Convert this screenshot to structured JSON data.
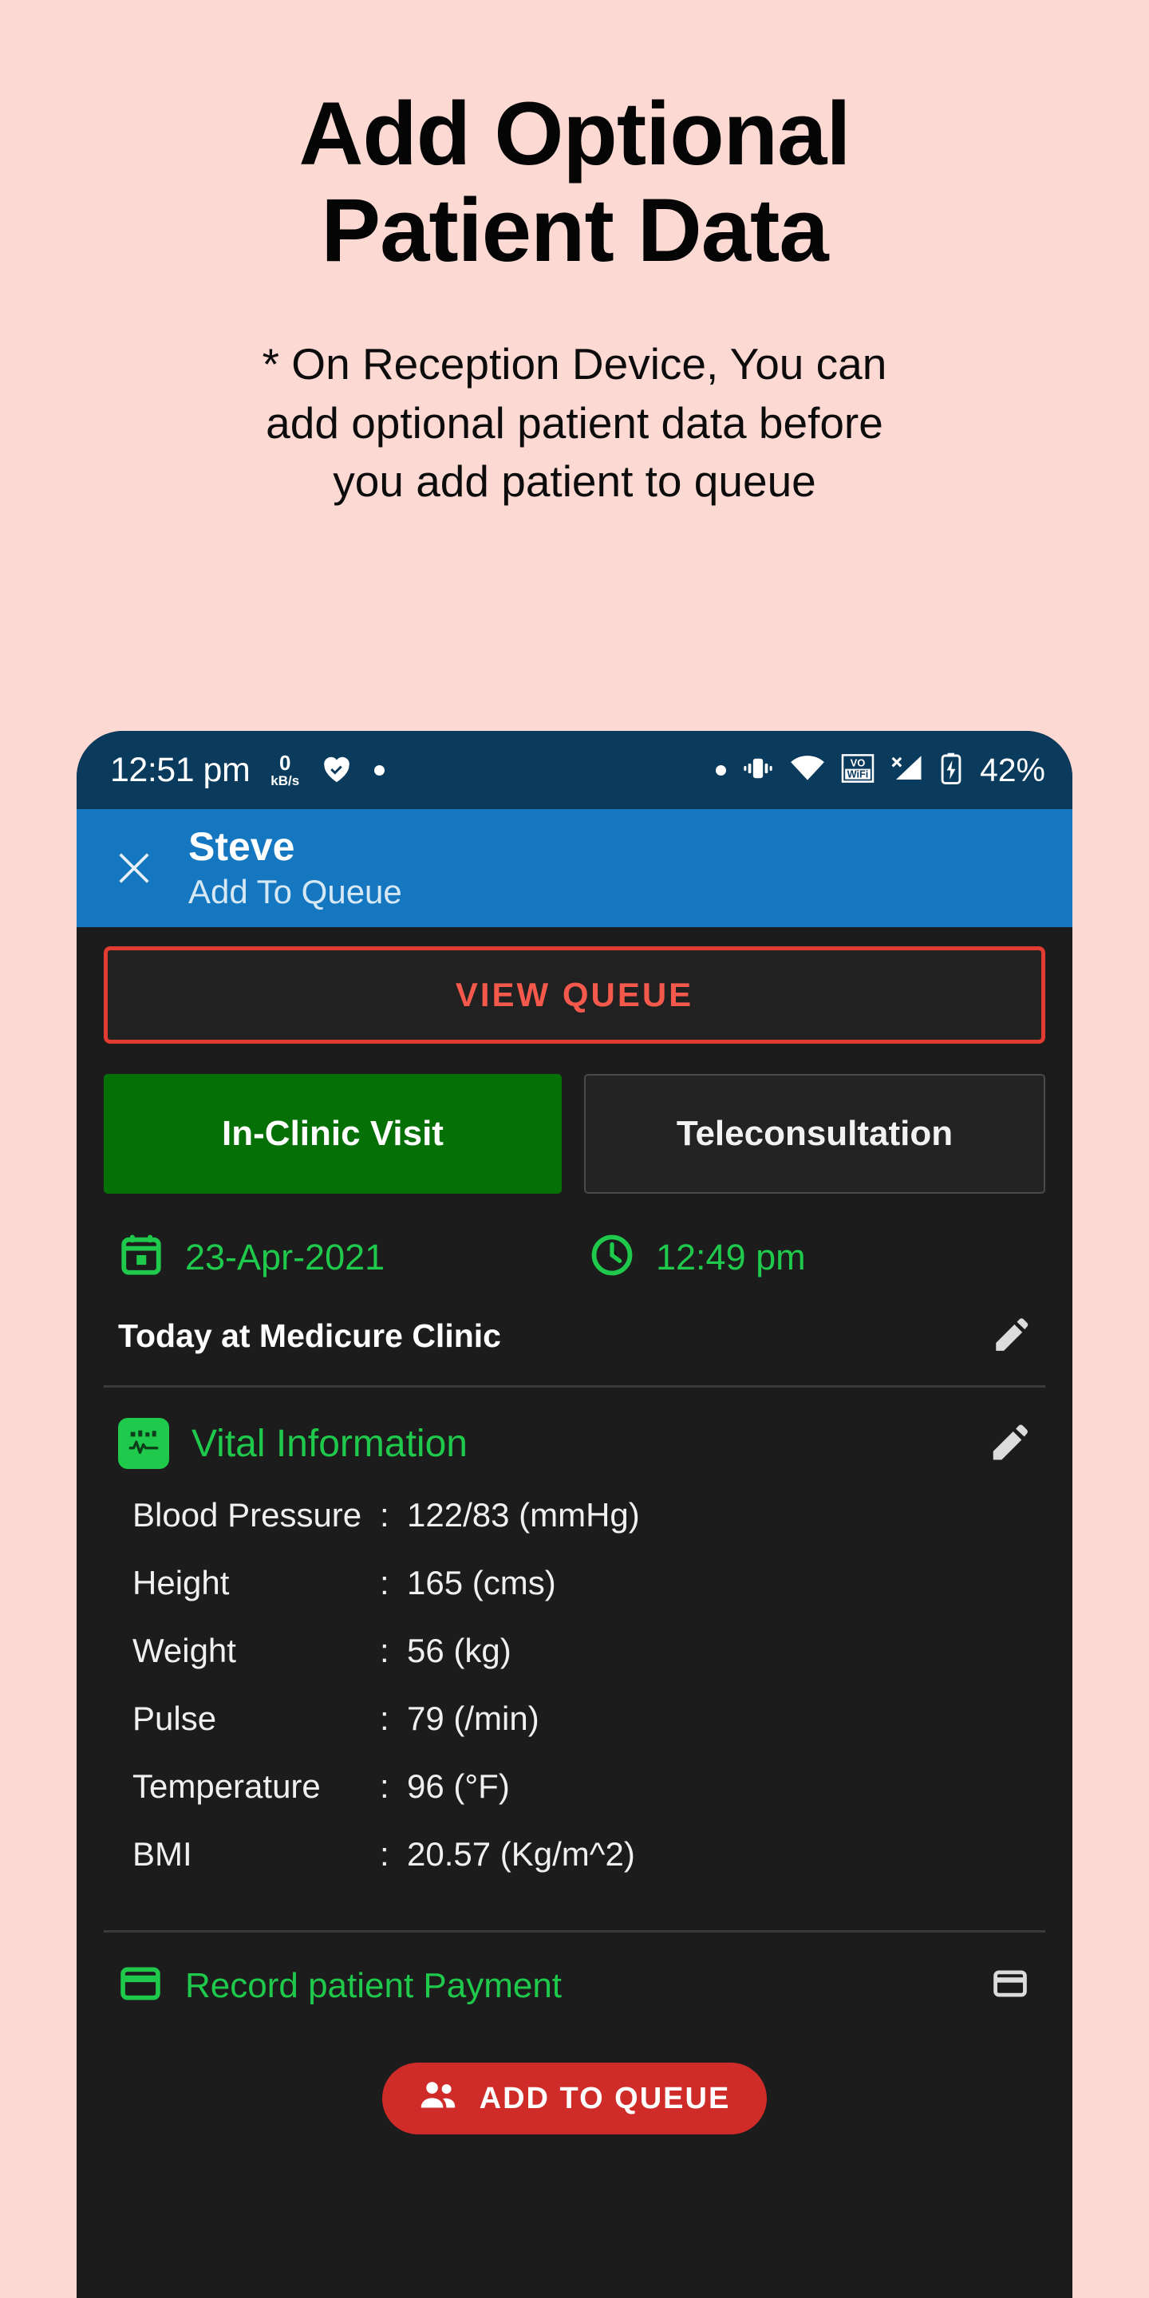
{
  "promo": {
    "headline_lines": [
      "Add Optional",
      "Patient Data"
    ],
    "subtitle_lines": [
      "* On Reception Device, You can",
      "add optional patient data before",
      "you add patient to queue"
    ],
    "background_color": "#fcd9d3"
  },
  "statusbar": {
    "time": "12:51 pm",
    "net_speed_value": "0",
    "net_speed_unit": "kB/s",
    "battery_percent": "42%",
    "icons": [
      "heart-check-icon",
      "dot-icon",
      "vibrate-icon",
      "wifi-icon",
      "volte-wifi-icon",
      "signal-off-icon",
      "battery-charging-icon"
    ],
    "background_color": "#0b3b5c"
  },
  "appbar": {
    "close_label": "✕",
    "title": "Steve",
    "subtitle": "Add To Queue",
    "background_color": "#1477c0"
  },
  "view_queue": {
    "label": "VIEW QUEUE",
    "text_color": "#f4594c",
    "border_color": "#e23b30"
  },
  "visit_tabs": [
    {
      "label": "In-Clinic Visit",
      "active": true,
      "color": "#057005"
    },
    {
      "label": "Teleconsultation",
      "active": false,
      "color": "#232323"
    }
  ],
  "appointment": {
    "date": "23-Apr-2021",
    "time": "12:49 pm",
    "clinic_line": "Today at Medicure Clinic",
    "accent_color": "#1fc94b"
  },
  "vital_section": {
    "title": "Vital Information",
    "rows": [
      {
        "label": "Blood Pressure",
        "separator": ":",
        "value": "122/83 (mmHg)"
      },
      {
        "label": "Height",
        "separator": ":",
        "value": "165 (cms)"
      },
      {
        "label": "Weight",
        "separator": ":",
        "value": "56 (kg)"
      },
      {
        "label": "Pulse",
        "separator": ":",
        "value": "79 (/min)"
      },
      {
        "label": "Temperature",
        "separator": ":",
        "value": "96 (°F)"
      },
      {
        "label": "BMI",
        "separator": ":",
        "value": "20.57 (Kg/m^2)"
      }
    ]
  },
  "payment": {
    "label": "Record patient Payment"
  },
  "cta": {
    "label": "ADD TO QUEUE",
    "color": "#cf2b28"
  }
}
